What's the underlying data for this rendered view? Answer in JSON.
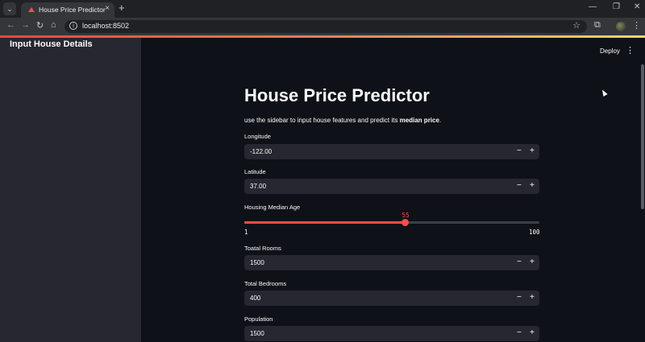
{
  "browser": {
    "tab_title": "House Price Predictor",
    "url": "localhost:8502"
  },
  "app": {
    "deploy_label": "Deploy",
    "sidebar_title": "Input House Details",
    "title": "House Price Predictor",
    "subtitle_pre": "use the sidebar to input house features and predict its ",
    "subtitle_bold": "median price",
    "subtitle_post": "."
  },
  "fields": {
    "longitude": {
      "label": "Longitude",
      "value": "-122.00"
    },
    "latitude": {
      "label": "Latitude",
      "value": "37.00"
    },
    "total_rooms": {
      "label": "Toatal Rooms",
      "value": "1500"
    },
    "total_bedrooms": {
      "label": "Total Bedrooms",
      "value": "400"
    },
    "population": {
      "label": "Population",
      "value": "1500"
    }
  },
  "slider": {
    "label": "Housing Median Age",
    "value": 55,
    "min": 1,
    "max": 100
  },
  "stepper": {
    "minus": "−",
    "plus": "+"
  },
  "icons": {
    "tab_menu": "chevron-down-icon",
    "close": "close-icon",
    "new_tab": "plus-icon",
    "back": "arrow-left-icon",
    "forward": "arrow-right-icon",
    "reload": "reload-icon",
    "home": "home-icon",
    "star": "star-icon",
    "extensions": "puzzle-icon",
    "kebab": "more-vertical-icon"
  },
  "colors": {
    "accent": "#ff4b4b",
    "sidebar_bg": "#262730",
    "main_bg": "#0e1117",
    "input_bg": "#262730"
  }
}
